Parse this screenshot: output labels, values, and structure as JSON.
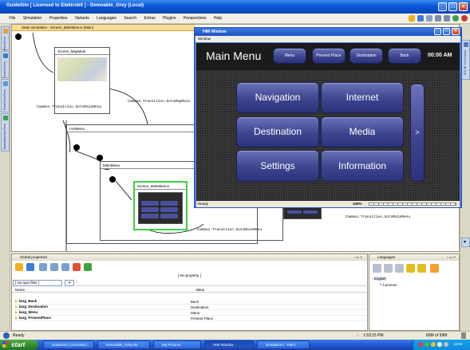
{
  "window": {
    "title": "GuideSim [ Licensed to Elektrobit ] - Demoable_Grey (Local)"
  },
  "menubar": [
    "File",
    "Simulation",
    "Properties",
    "Variants",
    "Languages",
    "Search",
    "Extras",
    "Plugins",
    "Perspectives",
    "Help"
  ],
  "left_tabs": [
    "ContentTree",
    "ScreenTree",
    "FlowChartTree",
    "StateMachineTree"
  ],
  "right_tabs": [
    "ICC48 Tool Panel"
  ],
  "canvas": {
    "tab_label": "State simulation - Screen_MainMenu1 (Main)",
    "states": {
      "map_main": "Screen_MapMain",
      "root_menu": "rootMenu",
      "main_menu": "MainMenu",
      "main_menu1": "Screen_MainMenu1"
    },
    "transitions": {
      "goto_map_main": "Common.Transition.GotoMapMain",
      "goto_main_menu_left": "Common.Transition.GotoMainMenu",
      "goto_main_menu_bottom": "Common.Transition.GotoMainMenu",
      "goto_main_menu_right": "Common.Transition.GotoMainMenu"
    }
  },
  "hmi": {
    "window_title": "HMI Window",
    "menu": "Window",
    "heading": "Main Menu",
    "top_buttons": [
      "Menu",
      "Present Place",
      "Destination",
      "Back"
    ],
    "clock": "00:00 AM",
    "grid": [
      "Navigation",
      "Internet",
      "Destination",
      "Media",
      "Settings",
      "Information"
    ],
    "next": ">",
    "status_left": "Ready",
    "zoom": "100%"
  },
  "properties": {
    "title": "Global properties",
    "no_property": "[ No property ]",
    "filter": "[ No type filter ]",
    "col_name": "Name",
    "col_value": "Value",
    "rows": [
      {
        "name": "lang_Back",
        "value": "Back"
      },
      {
        "name": "lang_Destination",
        "value": "Destination"
      },
      {
        "name": "lang_Menu",
        "value": "Menu"
      },
      {
        "name": "lang_PresentPlace",
        "value": "Present Place"
      }
    ]
  },
  "languages": {
    "title": "Languages",
    "items": [
      "English",
      "Common"
    ]
  },
  "status": {
    "left": "Ready",
    "time": "1:53:15 PM",
    "memory": "80M of 99M"
  },
  "taskbar": {
    "start": "start",
    "tasks": [
      "GuideSim [ Licensed t...",
      "Demoable_Grey.vkr - ...",
      "My Pictures",
      "HMI Window",
      "simulation1 - Paint"
    ],
    "clock": "13:53"
  }
}
